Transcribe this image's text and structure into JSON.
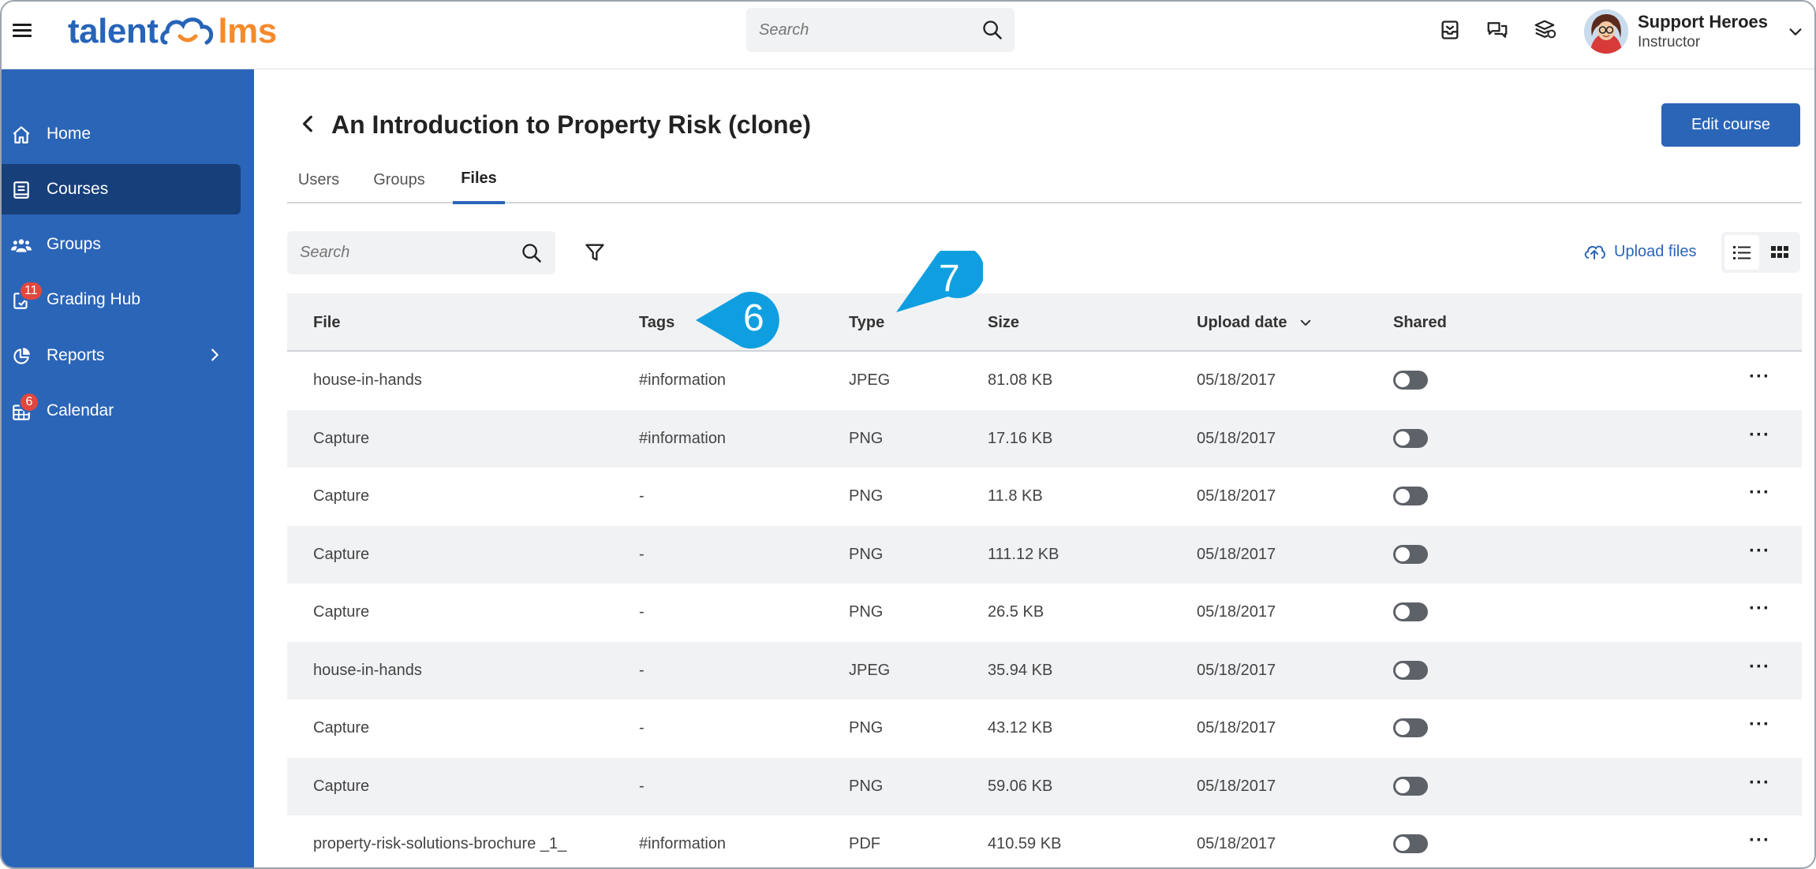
{
  "header": {
    "logo_left": "talent",
    "logo_right": "lms",
    "search_placeholder": "Search",
    "user_name": "Support Heroes",
    "user_role": "Instructor"
  },
  "sidebar": {
    "items": [
      {
        "label": "Home"
      },
      {
        "label": "Courses"
      },
      {
        "label": "Groups"
      },
      {
        "label": "Grading Hub",
        "badge": "11"
      },
      {
        "label": "Reports"
      },
      {
        "label": "Calendar",
        "badge": "6"
      }
    ]
  },
  "page": {
    "title": "An Introduction to Property Risk (clone)",
    "edit_label": "Edit course",
    "tabs": [
      "Users",
      "Groups",
      "Files"
    ],
    "search_placeholder": "Search",
    "upload_label": "Upload files"
  },
  "table": {
    "headers": [
      "File",
      "Tags",
      "Type",
      "Size",
      "Upload date",
      "Shared"
    ],
    "rows": [
      {
        "file": "house-in-hands",
        "tags": "#information",
        "type": "JPEG",
        "size": "81.08 KB",
        "date": "05/18/2017"
      },
      {
        "file": "Capture",
        "tags": "#information",
        "type": "PNG",
        "size": "17.16 KB",
        "date": "05/18/2017"
      },
      {
        "file": "Capture",
        "tags": "-",
        "type": "PNG",
        "size": "11.8 KB",
        "date": "05/18/2017"
      },
      {
        "file": "Capture",
        "tags": "-",
        "type": "PNG",
        "size": "111.12 KB",
        "date": "05/18/2017"
      },
      {
        "file": "Capture",
        "tags": "-",
        "type": "PNG",
        "size": "26.5 KB",
        "date": "05/18/2017"
      },
      {
        "file": "house-in-hands",
        "tags": "-",
        "type": "JPEG",
        "size": "35.94 KB",
        "date": "05/18/2017"
      },
      {
        "file": "Capture",
        "tags": "-",
        "type": "PNG",
        "size": "43.12 KB",
        "date": "05/18/2017"
      },
      {
        "file": "Capture",
        "tags": "-",
        "type": "PNG",
        "size": "59.06 KB",
        "date": "05/18/2017"
      },
      {
        "file": "property-risk-solutions-brochure _1_",
        "tags": "#information",
        "type": "PDF",
        "size": "410.59 KB",
        "date": "05/18/2017"
      }
    ],
    "more_label": "···"
  },
  "callouts": [
    "6",
    "7"
  ],
  "colors": {
    "brand_blue": "#2b65b8",
    "brand_orange": "#f58a2b",
    "sidebar_active": "#173f7a",
    "badge_red": "#e2473f",
    "callout_blue": "#0f9fe0"
  }
}
